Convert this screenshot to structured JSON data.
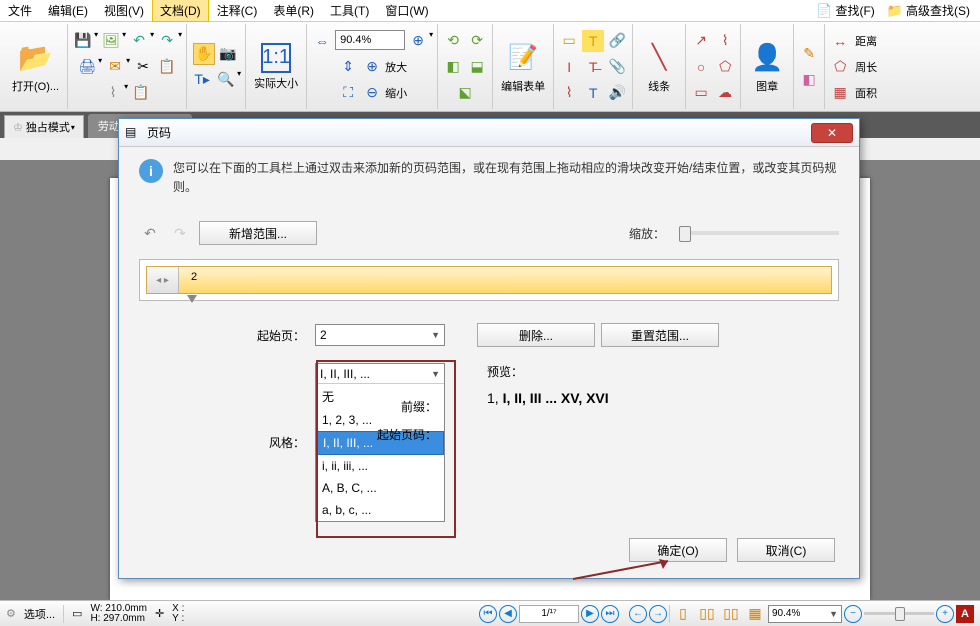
{
  "menu": {
    "file": "文件",
    "edit": "编辑(E)",
    "view": "视图(V)",
    "document": "文档(D)",
    "annotate": "注释(C)",
    "form": "表单(R)",
    "tool": "工具(T)",
    "window": "窗口(W)",
    "find": "查找(F)",
    "advfind": "高级查找(S)"
  },
  "toolbar": {
    "open": "打开(O)...",
    "actualsize": "实际大小",
    "zoomval": "90.4%",
    "zoomin": "放大",
    "zoomout": "缩小",
    "editform": "编辑表单",
    "line": "线条",
    "stamp": "图章",
    "distance": "距离",
    "perimeter": "周长",
    "area": "面积"
  },
  "mode": "独占模式",
  "tab": "劳动合同书(普通)",
  "dialog": {
    "title": "页码",
    "info": "您可以在下面的工具栏上通过双击来添加新的页码范围，或在现有范围上拖动相应的滑块改变开始/结束位置，或改变其页码规则。",
    "add_range": "新增范围...",
    "zoom_lbl": "缩放：",
    "ruler_mark": "2",
    "start_page_lbl": "起始页：",
    "start_page_val": "2",
    "delete": "删除...",
    "reset": "重置范围...",
    "style_lbl": "风格：",
    "style_sel": "I, II, III, ...",
    "prefix_lbl": "前缀：",
    "startnum_lbl": "起始页码：",
    "options": {
      "none": "无",
      "arabic": "1, 2, 3, ...",
      "roman_upper": "I, II, III, ...",
      "roman_lower": "i, ii, iii, ...",
      "alpha_upper": "A, B, C, ...",
      "alpha_lower": "a, b, c, ..."
    },
    "preview_lbl": "预览：",
    "preview_val": "1, I, II, III ... XV, XVI",
    "ok": "确定(O)",
    "cancel": "取消(C)"
  },
  "status": {
    "options": "选项...",
    "w": "W:  210.0mm",
    "h": "H:  297.0mm",
    "x": "X :",
    "y": "Y :",
    "page": "1/¹⁷",
    "zoom": "90.4%"
  }
}
